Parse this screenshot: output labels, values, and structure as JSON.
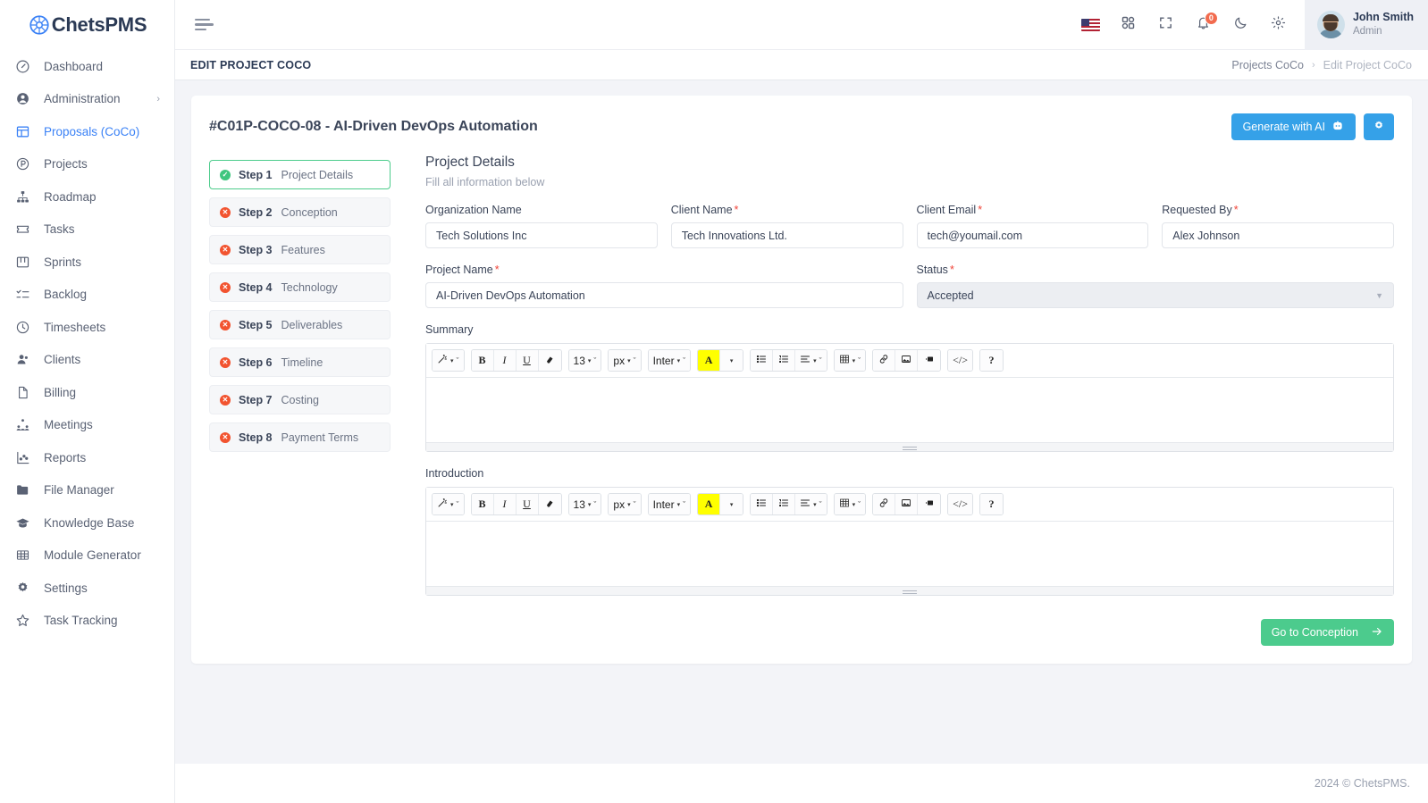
{
  "brand": {
    "name_prefix": "C",
    "name": "hetsPMS"
  },
  "sidebar": {
    "items": [
      {
        "label": "Dashboard",
        "icon": "gauge-icon"
      },
      {
        "label": "Administration",
        "icon": "user-circle-icon",
        "chevron": "›"
      },
      {
        "label": "Proposals (CoCo)",
        "icon": "layout-icon"
      },
      {
        "label": "Projects",
        "icon": "p-circle-icon"
      },
      {
        "label": "Roadmap",
        "icon": "sitemap-icon"
      },
      {
        "label": "Tasks",
        "icon": "ticket-icon"
      },
      {
        "label": "Sprints",
        "icon": "columns-icon"
      },
      {
        "label": "Backlog",
        "icon": "checklist-icon"
      },
      {
        "label": "Timesheets",
        "icon": "clock-icon"
      },
      {
        "label": "Clients",
        "icon": "user-group-icon"
      },
      {
        "label": "Billing",
        "icon": "file-icon"
      },
      {
        "label": "Meetings",
        "icon": "people-network-icon"
      },
      {
        "label": "Reports",
        "icon": "chart-icon"
      },
      {
        "label": "File Manager",
        "icon": "folder-icon"
      },
      {
        "label": "Knowledge Base",
        "icon": "graduation-cap-icon"
      },
      {
        "label": "Module Generator",
        "icon": "grid-table-icon"
      },
      {
        "label": "Settings",
        "icon": "gear-icon"
      },
      {
        "label": "Task Tracking",
        "icon": "star-icon"
      }
    ]
  },
  "header": {
    "menu_icon": "hamburger-icon",
    "flag": "us-flag-icon",
    "apps_icon": "grid-apps-icon",
    "fullscreen_icon": "fullscreen-icon",
    "bell_icon": "bell-icon",
    "bell_badge": "0",
    "theme_icon": "moon-icon",
    "settings_icon": "gear-icon",
    "user_name": "John Smith",
    "user_role": "Admin"
  },
  "titlebar": {
    "page_title": "EDIT PROJECT COCO",
    "breadcrumb": [
      "Projects CoCo",
      "Edit Project CoCo"
    ],
    "breadcrumb_separator": "›"
  },
  "card": {
    "title": "#C01P-COCO-08 - AI-Driven DevOps Automation",
    "generate_button": "Generate with AI",
    "generate_icon": "robot-icon",
    "settings_button_icon": "gear-icon"
  },
  "steps": [
    {
      "num": "Step 1",
      "label": "Project Details",
      "state": "done"
    },
    {
      "num": "Step 2",
      "label": "Conception",
      "state": "pending"
    },
    {
      "num": "Step 3",
      "label": "Features",
      "state": "pending"
    },
    {
      "num": "Step 4",
      "label": "Technology",
      "state": "pending"
    },
    {
      "num": "Step 5",
      "label": "Deliverables",
      "state": "pending"
    },
    {
      "num": "Step 6",
      "label": "Timeline",
      "state": "pending"
    },
    {
      "num": "Step 7",
      "label": "Costing",
      "state": "pending"
    },
    {
      "num": "Step 8",
      "label": "Payment Terms",
      "state": "pending"
    }
  ],
  "form": {
    "title": "Project Details",
    "subtitle": "Fill all information below",
    "organization_name": {
      "label": "Organization Name",
      "value": "Tech Solutions Inc",
      "required": false
    },
    "client_name": {
      "label": "Client Name",
      "value": "Tech Innovations Ltd.",
      "required": true
    },
    "client_email": {
      "label": "Client Email",
      "value": "tech@youmail.com",
      "required": true
    },
    "requested_by": {
      "label": "Requested By",
      "value": "Alex Johnson",
      "required": true
    },
    "project_name": {
      "label": "Project Name",
      "value": "AI-Driven DevOps Automation",
      "required": true
    },
    "status": {
      "label": "Status",
      "value": "Accepted",
      "required": true
    },
    "summary": {
      "label": "Summary",
      "value": ""
    },
    "introduction": {
      "label": "Introduction",
      "value": ""
    },
    "required_mark": "*"
  },
  "editor_toolbar": {
    "magic": "✨",
    "bold": "B",
    "italic": "I",
    "underline": "U",
    "clear_format": "eraser-icon",
    "font_size": "13",
    "unit": "px",
    "font_family": "Inter",
    "highlight": "A",
    "bullet_list": "bullet-list-icon",
    "numbered_list": "numbered-list-icon",
    "align": "align-icon",
    "table": "table-icon",
    "link": "link-icon",
    "image": "image-icon",
    "video": "video-icon",
    "code": "</>",
    "help": "?",
    "caret": "▾",
    "chevron": "ˇ"
  },
  "next_button": {
    "label": "Go to Conception",
    "icon": "arrow-right-icon"
  },
  "footer": {
    "text": "2024 © ChetsPMS."
  },
  "colors": {
    "accent_blue": "#35a1e8",
    "sidebar_active": "#3b82f6",
    "success_green": "#4ccb8d",
    "danger_red": "#f2532f",
    "badge_orange": "#f26b4e"
  }
}
